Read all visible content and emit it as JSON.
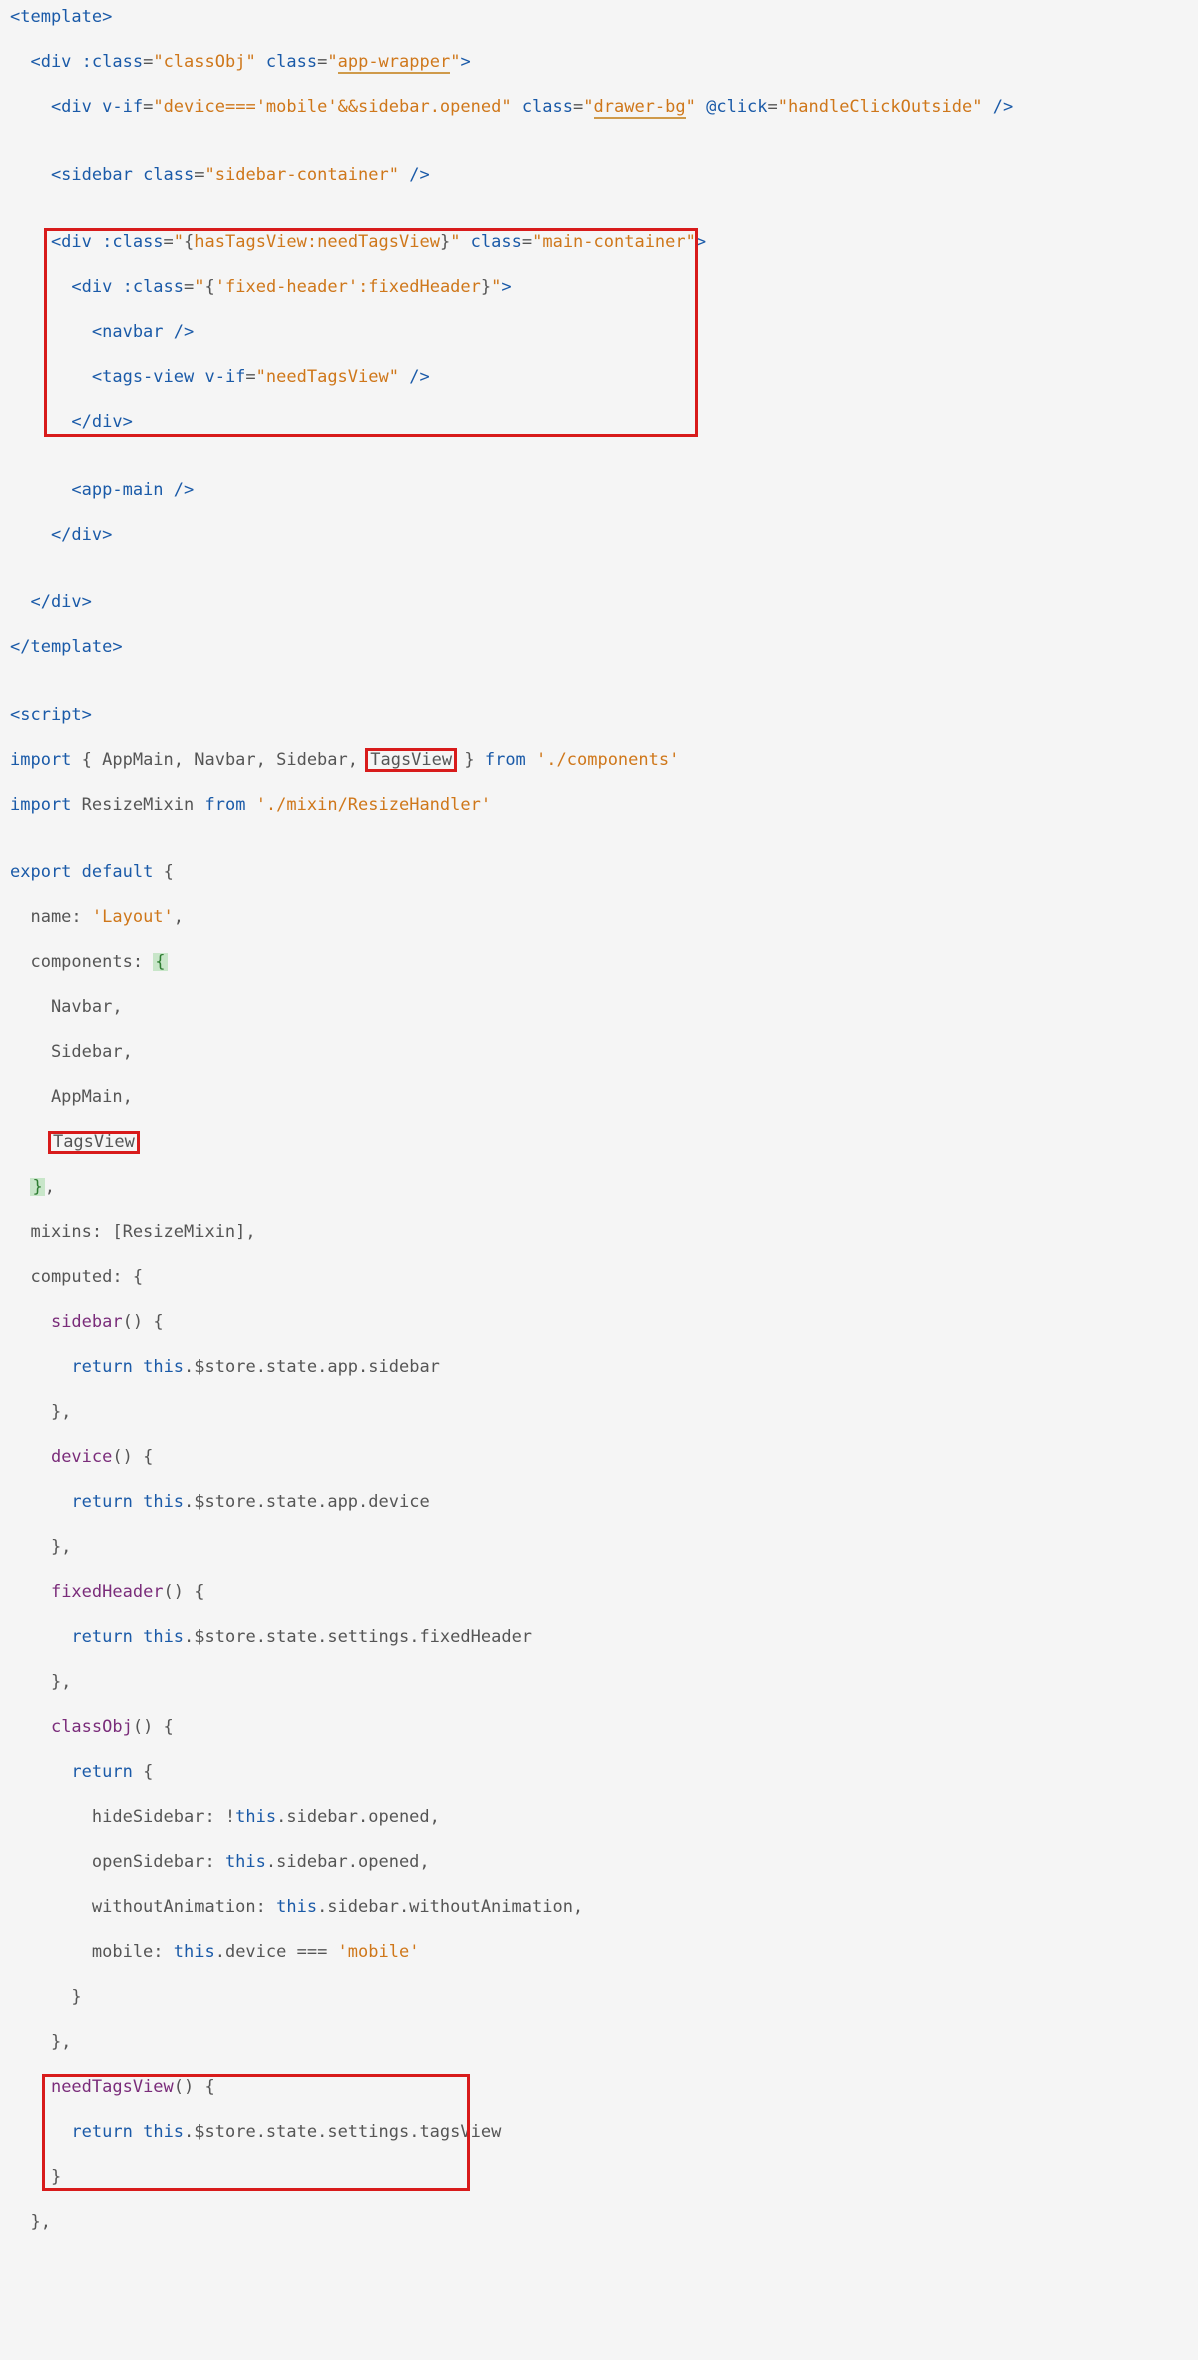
{
  "code": {
    "l1": "<template>",
    "l2a": "  <div ",
    "l2b": ":class",
    "l2c": "=",
    "l2d": "\"classObj\"",
    "l2e": " class",
    "l2f": "=",
    "l2g1": "\"",
    "l2g2": "app-wrapper",
    "l2g3": "\"",
    "l2h": ">",
    "l3a": "    <div ",
    "l3b": "v-if",
    "l3c": "=",
    "l3d": "\"device===",
    "l3d2": "'mobile'",
    "l3d3": "&&sidebar.opened\"",
    "l3e": " class",
    "l3f": "=",
    "l3g1": "\"",
    "l3g2": "drawer-bg",
    "l3g3": "\"",
    "l3h": " @click",
    "l3i": "=",
    "l3j1": "\"handleClickOutside\"",
    "l3k": " />",
    "l4": "",
    "l5a": "    <sidebar ",
    "l5b": "class",
    "l5c": "=",
    "l5d": "\"sidebar-container\"",
    "l5e": " />",
    "l6": "",
    "l7a": "    <div ",
    "l7b": ":class",
    "l7c": "=",
    "l7d1": "\"",
    "l7d2": "{",
    "l7d3": "hasTagsView:needTagsView",
    "l7d4": "}",
    "l7d5": "\"",
    "l7e": " class",
    "l7f": "=",
    "l7g1": "\"main-container\"",
    "l7h": ">",
    "l8a": "      <div ",
    "l8b": ":class",
    "l8c": "=",
    "l8d1": "\"",
    "l8d2": "{",
    "l8d3": "'fixed-header'",
    "l8d4": ":fixedHeader",
    "l8d5": "}",
    "l8d6": "\"",
    "l8e": ">",
    "l9": "        <navbar />",
    "l10a": "        <tags-view ",
    "l10b": "v-if",
    "l10c": "=",
    "l10d": "\"needTagsView\"",
    "l10e": " />",
    "l11": "      </div>",
    "l12": "",
    "l13": "      <app-main />",
    "l14": "    </div>",
    "l15": "",
    "l16": "  </div>",
    "l17": "</template>",
    "l18": "",
    "l19a": "<script>",
    "l20a": "import",
    "l20b": " { AppMain, Navbar, Sidebar, ",
    "l20c": "TagsView",
    "l20d": " } ",
    "l20e": "from",
    "l20f": " ",
    "l20g": "'./components'",
    "l21a": "import",
    "l21b": " ResizeMixin ",
    "l21c": "from",
    "l21d": " ",
    "l21e": "'./mixin/ResizeHandler'",
    "l22": "",
    "l23a": "export",
    "l23b": " ",
    "l23c": "default",
    "l23d": " {",
    "l24a": "  name: ",
    "l24b": "'Layout'",
    "l24c": ",",
    "l25a": "  components: ",
    "l25b": "{",
    "l26": "    Navbar,",
    "l27": "    Sidebar,",
    "l28": "    AppMain,",
    "l29": "    ",
    "l29b": "TagsView",
    "l30a": "  ",
    "l30b": "}",
    "l30c": ",",
    "l31": "  mixins: [ResizeMixin],",
    "l32": "  computed: {",
    "l33a": "    ",
    "l33b": "sidebar",
    "l33c": "() {",
    "l34a": "      ",
    "l34b": "return",
    "l34c": " ",
    "l34d": "this",
    "l34e": ".$store.state.app.sidebar",
    "l35": "    },",
    "l36a": "    ",
    "l36b": "device",
    "l36c": "() {",
    "l37a": "      ",
    "l37b": "return",
    "l37c": " ",
    "l37d": "this",
    "l37e": ".$store.state.app.device",
    "l38": "    },",
    "l39a": "    ",
    "l39b": "fixedHeader",
    "l39c": "() {",
    "l40a": "      ",
    "l40b": "return",
    "l40c": " ",
    "l40d": "this",
    "l40e": ".$store.state.settings.fixedHeader",
    "l41": "    },",
    "l42a": "    ",
    "l42b": "classObj",
    "l42c": "() {",
    "l43a": "      ",
    "l43b": "return",
    "l43c": " {",
    "l44a": "        hideSidebar: !",
    "l44b": "this",
    "l44c": ".sidebar.opened,",
    "l45a": "        openSidebar: ",
    "l45b": "this",
    "l45c": ".sidebar.opened,",
    "l46a": "        withoutAnimation: ",
    "l46b": "this",
    "l46c": ".sidebar.withoutAnimation,",
    "l47a": "        mobile: ",
    "l47b": "this",
    "l47c": ".device === ",
    "l47d": "'mobile'",
    "l48": "      }",
    "l49": "    },",
    "l50a": "    ",
    "l50b": "needTagsView",
    "l50c": "() {",
    "l51a": "      ",
    "l51b": "return",
    "l51c": " ",
    "l51d": "this",
    "l51e": ".$store.state.settings.tagsView",
    "l52": "    }",
    "l53": "  },"
  }
}
